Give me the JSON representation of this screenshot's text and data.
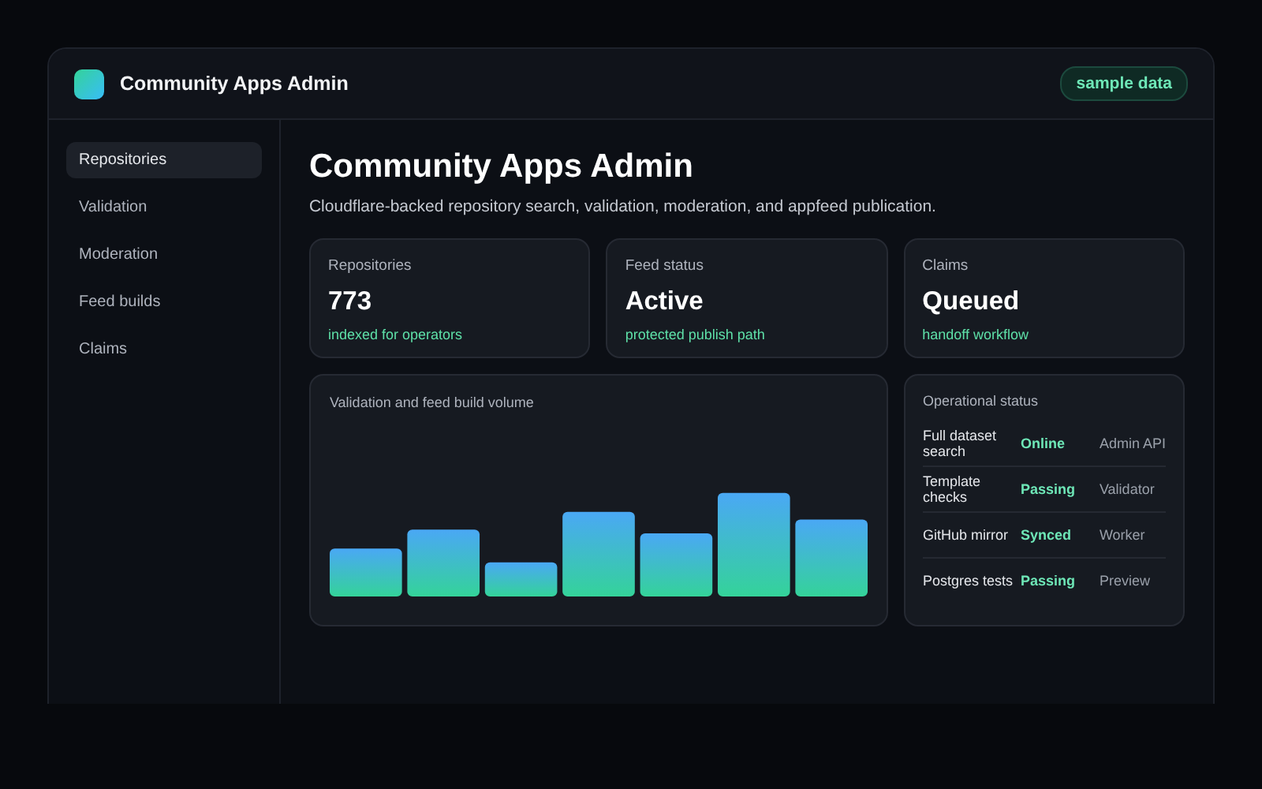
{
  "header": {
    "title": "Community Apps Admin",
    "badge": "sample data"
  },
  "sidebar": {
    "items": [
      {
        "label": "Repositories",
        "selected": true
      },
      {
        "label": "Validation",
        "selected": false
      },
      {
        "label": "Moderation",
        "selected": false
      },
      {
        "label": "Feed builds",
        "selected": false
      },
      {
        "label": "Claims",
        "selected": false
      }
    ]
  },
  "main": {
    "title": "Community Apps Admin",
    "subtitle": "Cloudflare-backed repository search, validation, moderation, and appfeed publication.",
    "stats": [
      {
        "label": "Repositories",
        "value": "773",
        "note": "indexed for operators"
      },
      {
        "label": "Feed status",
        "value": "Active",
        "note": "protected publish path"
      },
      {
        "label": "Claims",
        "value": "Queued",
        "note": "handoff workflow"
      }
    ],
    "chart": {
      "title": "Validation and feed build volume"
    },
    "status": {
      "title": "Operational status",
      "rows": [
        {
          "name": "Full dataset search",
          "state": "Online",
          "owner": "Admin API"
        },
        {
          "name": "Template checks",
          "state": "Passing",
          "owner": "Validator"
        },
        {
          "name": "GitHub mirror",
          "state": "Synced",
          "owner": "Worker"
        },
        {
          "name": "Postgres tests",
          "state": "Passing",
          "owner": "Preview"
        }
      ]
    }
  }
}
